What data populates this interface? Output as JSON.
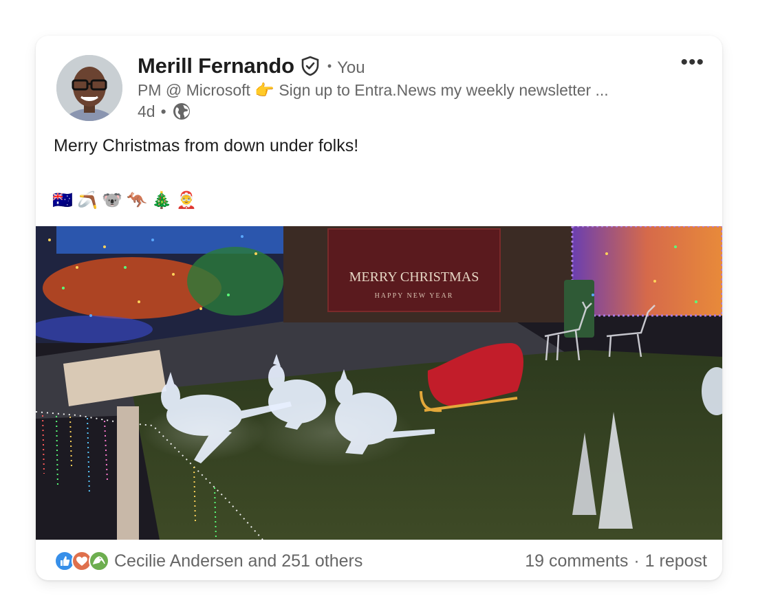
{
  "post": {
    "author": {
      "name": "Merill Fernando",
      "relation": "You",
      "headline": "PM @ Microsoft 👉 Sign up to Entra.News my weekly newsletter ...",
      "age": "4d"
    },
    "text": "Merry Christmas from down under folks!",
    "emojis": [
      "🇦🇺",
      "🪃",
      "🐨",
      "🦘",
      "🎄",
      "🤶"
    ],
    "photo_banner": {
      "line1": "MERRY CHRISTMAS",
      "line2": "HAPPY NEW YEAR"
    },
    "reactions": {
      "icons": [
        "like-icon",
        "love-icon",
        "support-icon"
      ],
      "summary": "Cecilie Andersen and 251 others"
    },
    "stats": {
      "comments": "19 comments",
      "reposts": "1 repost"
    }
  },
  "colors": {
    "like": "#378fe9",
    "love": "#df704d",
    "support": "#6dae4f",
    "text_secondary": "#666666"
  }
}
